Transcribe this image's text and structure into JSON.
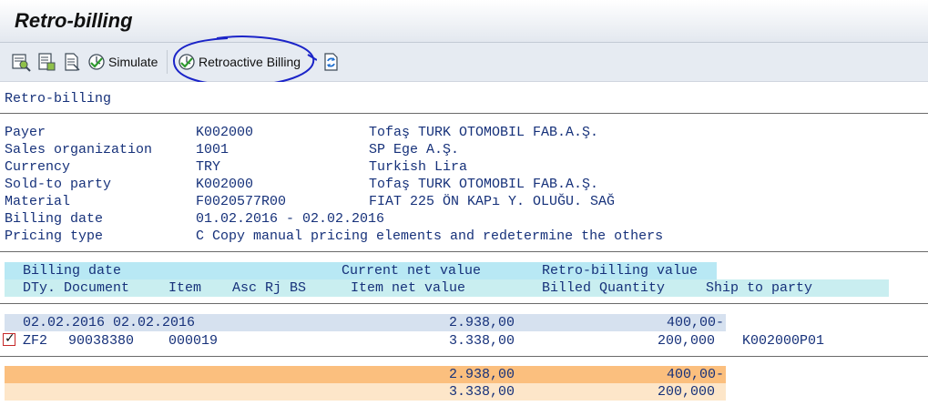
{
  "title": "Retro-billing",
  "toolbar": {
    "simulate_label": "Simulate",
    "retro_label": "Retroactive Billing",
    "icons": [
      "display-variant-icon",
      "details-icon",
      "document-icon",
      "execute-icon",
      "execute-icon",
      "refresh-icon"
    ]
  },
  "section_title": "Retro-billing",
  "header_fields": [
    {
      "label": "Payer",
      "value": "K002000",
      "desc": "Tofaş TURK OTOMOBIL FAB.A.Ş."
    },
    {
      "label": "Sales organization",
      "value": "1001",
      "desc": "SP Ege A.Ş."
    },
    {
      "label": "Currency",
      "value": "TRY",
      "desc": "Turkish Lira"
    },
    {
      "label": "Sold-to party",
      "value": "K002000",
      "desc": "Tofaş TURK OTOMOBIL FAB.A.Ş."
    },
    {
      "label": "Material",
      "value": "F0020577R00",
      "desc": "FIAT 225 ÖN KAPı Y. OLUĞU. SAĞ"
    },
    {
      "label": "Billing date",
      "value": "01.02.2016 - 02.02.2016",
      "desc": ""
    },
    {
      "label": "Pricing type",
      "value": "C Copy manual pricing elements and redetermine the others",
      "desc": ""
    }
  ],
  "table_header": {
    "row1": {
      "col1": "Billing date",
      "col2": "Current net value",
      "col3": "Retro-billing value"
    },
    "row2": {
      "col1": "DTy. Document",
      "col2": "Item",
      "col3": "Asc Rj BS",
      "col4": "Item net value",
      "col5": "Billed Quantity",
      "col6": "Ship to party"
    }
  },
  "group_row": {
    "dates": "02.02.2016 02.02.2016",
    "current": "2.938,00",
    "retro": "400,00-"
  },
  "item_row": {
    "checked": true,
    "dty": "ZF2",
    "document": "90038380",
    "item": "000019",
    "net": "3.338,00",
    "qty": "200,000",
    "ship": "K002000P01"
  },
  "totals": [
    {
      "current": "2.938,00",
      "retro": "400,00-"
    },
    {
      "current": "3.338,00",
      "retro": "200,000"
    }
  ],
  "colors": {
    "header_band": "#b8e8f4",
    "header_band2": "#c9eef0",
    "group_band": "#d6e1ef",
    "total1": "#fbbf7e",
    "total2": "#fde6c9",
    "text": "#16317a",
    "annotation": "#1b24c8"
  }
}
